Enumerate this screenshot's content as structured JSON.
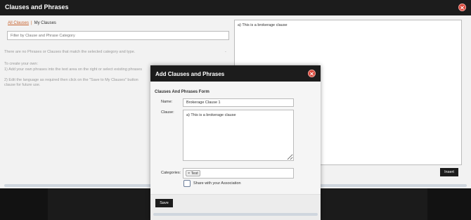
{
  "outer": {
    "title": "Clauses and Phrases",
    "tabs": {
      "all": "All Clauses",
      "separator": "|",
      "mine": "My Clauses"
    },
    "filter_placeholder": "Filter by Clause and Phrase Category",
    "no_phrases_text": "There are no Phrases or Clauses that match the selected category and type.",
    "dot": "-",
    "help_lines": [
      "To create your own:",
      "1) Add your own phrases into the text area on the right or select existing phrases",
      "",
      "2) Edit the language as required then click on the \"Save to My Clauses\" button",
      "clause for future use."
    ],
    "clause_text": "a) This is a brokerage clause",
    "insert_label": "Insert"
  },
  "dialog": {
    "title": "Add Clauses and Phrases",
    "form_title": "Clauses And Phrases Form",
    "name_label": "Name:",
    "name_value": "Brokerage Clause 1",
    "clause_label": "Clause:",
    "clause_value": "a) This is a brokerage clause",
    "categories_label": "Categories:",
    "category_chip_remove": "×",
    "category_chip": "Test",
    "share_label": "Share with your Association",
    "save_label": "Save"
  },
  "colors": {
    "header_bg": "#1c1c1c",
    "close_red": "#d8473a",
    "tab_accent": "#c8632e",
    "checkbox_border": "#6b7d99"
  }
}
